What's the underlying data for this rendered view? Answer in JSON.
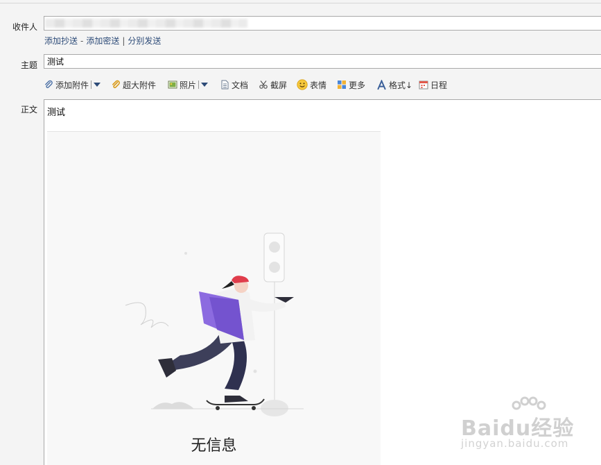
{
  "recipient": {
    "label": "收件人",
    "value": ""
  },
  "recipient_links": {
    "add_cc": "添加抄送",
    "sep1": "-",
    "add_bcc": "添加密送",
    "sep2": "|",
    "separate_send": "分别发送"
  },
  "subject": {
    "label": "主题",
    "value": "测试"
  },
  "toolbar": {
    "attach": "添加附件",
    "large_attach": "超大附件",
    "photo": "照片",
    "document": "文档",
    "screenshot": "截屏",
    "emoji": "表情",
    "more": "更多",
    "format": "格式↓",
    "schedule": "日程"
  },
  "body": {
    "label": "正文",
    "text": "测试",
    "empty_state": "无信息"
  },
  "watermark": {
    "brand": "Baidu经验",
    "site": "jingyan.baidu.com"
  },
  "colors": {
    "link": "#2d4b78",
    "accent_purple": "#7c5fd3",
    "helmet_red": "#e03c4b"
  }
}
